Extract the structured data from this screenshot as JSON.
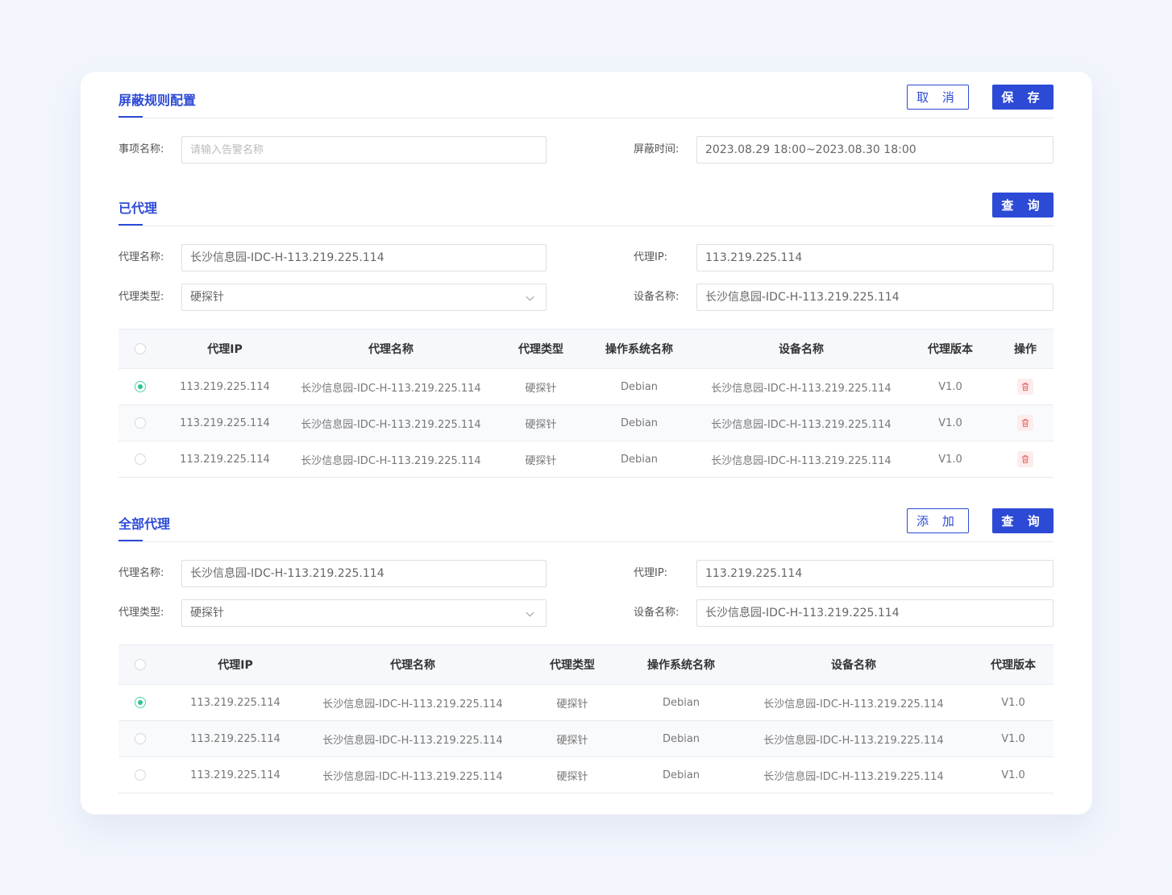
{
  "config": {
    "title": "屏蔽规则配置",
    "cancel_label": "取 消",
    "save_label": "保 存",
    "item_name_label": "事项名称:",
    "item_name_placeholder": "请输入告警名称",
    "block_time_label": "屏蔽时间:",
    "block_time_value": "2023.08.29 18:00~2023.08.30 18:00"
  },
  "proxied": {
    "title": "已代理",
    "query_label": "查 询",
    "filters": {
      "name_label": "代理名称:",
      "name_value": "长沙信息园-IDC-H-113.219.225.114",
      "ip_label": "代理IP:",
      "ip_value": "113.219.225.114",
      "type_label": "代理类型:",
      "type_value": "硬探针",
      "device_label": "设备名称:",
      "device_value": "长沙信息园-IDC-H-113.219.225.114"
    },
    "columns": [
      "代理IP",
      "代理名称",
      "代理类型",
      "操作系统名称",
      "设备名称",
      "代理版本",
      "操作"
    ],
    "rows": [
      {
        "selected": true,
        "ip": "113.219.225.114",
        "name": "长沙信息园-IDC-H-113.219.225.114",
        "type": "硬探针",
        "os": "Debian",
        "device": "长沙信息园-IDC-H-113.219.225.114",
        "version": "V1.0"
      },
      {
        "selected": false,
        "ip": "113.219.225.114",
        "name": "长沙信息园-IDC-H-113.219.225.114",
        "type": "硬探针",
        "os": "Debian",
        "device": "长沙信息园-IDC-H-113.219.225.114",
        "version": "V1.0"
      },
      {
        "selected": false,
        "ip": "113.219.225.114",
        "name": "长沙信息园-IDC-H-113.219.225.114",
        "type": "硬探针",
        "os": "Debian",
        "device": "长沙信息园-IDC-H-113.219.225.114",
        "version": "V1.0"
      }
    ]
  },
  "all_proxies": {
    "title": "全部代理",
    "add_label": "添 加",
    "query_label": "查 询",
    "filters": {
      "name_label": "代理名称:",
      "name_value": "长沙信息园-IDC-H-113.219.225.114",
      "ip_label": "代理IP:",
      "ip_value": "113.219.225.114",
      "type_label": "代理类型:",
      "type_value": "硬探针",
      "device_label": "设备名称:",
      "device_value": "长沙信息园-IDC-H-113.219.225.114"
    },
    "columns": [
      "代理IP",
      "代理名称",
      "代理类型",
      "操作系统名称",
      "设备名称",
      "代理版本"
    ],
    "rows": [
      {
        "selected": true,
        "ip": "113.219.225.114",
        "name": "长沙信息园-IDC-H-113.219.225.114",
        "type": "硬探针",
        "os": "Debian",
        "device": "长沙信息园-IDC-H-113.219.225.114",
        "version": "V1.0"
      },
      {
        "selected": false,
        "ip": "113.219.225.114",
        "name": "长沙信息园-IDC-H-113.219.225.114",
        "type": "硬探针",
        "os": "Debian",
        "device": "长沙信息园-IDC-H-113.219.225.114",
        "version": "V1.0"
      },
      {
        "selected": false,
        "ip": "113.219.225.114",
        "name": "长沙信息园-IDC-H-113.219.225.114",
        "type": "硬探针",
        "os": "Debian",
        "device": "长沙信息园-IDC-H-113.219.225.114",
        "version": "V1.0"
      }
    ]
  },
  "icons": {
    "delete": "trash-icon",
    "select": "chevron-down-icon"
  },
  "colors": {
    "accent": "#2d4ad6",
    "selected_radio": "#2fc48e",
    "delete": "#e86b6b"
  }
}
